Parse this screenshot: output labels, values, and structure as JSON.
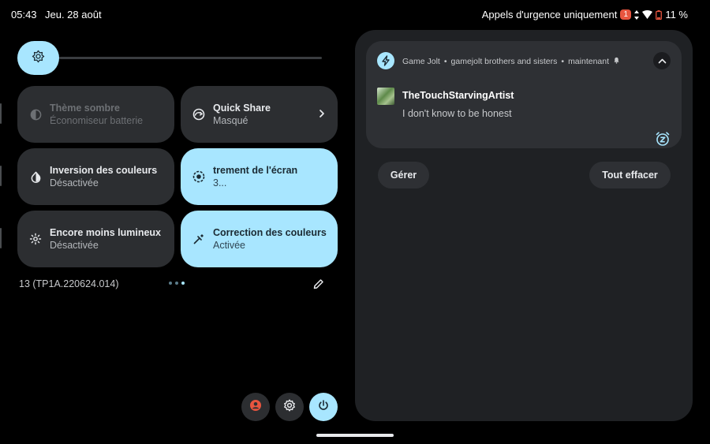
{
  "status_bar": {
    "time": "05:43",
    "date": "Jeu. 28 août",
    "carrier_text": "Appels d'urgence uniquement",
    "notification_count": "1",
    "battery": "11 %"
  },
  "quick_settings": {
    "tiles": [
      {
        "label": "Thème sombre",
        "sublabel": "Économiseur batterie",
        "icon": "dark-theme-icon",
        "state": "unavailable"
      },
      {
        "label": "Quick Share",
        "sublabel": "Masqué",
        "icon": "quick-share-icon",
        "state": "off"
      },
      {
        "label": "Inversion des couleurs",
        "sublabel": "Désactivée",
        "icon": "color-inversion-icon",
        "state": "off"
      },
      {
        "label": "trement de l'écran",
        "sublabel": "3...",
        "icon": "screen-record-icon",
        "state": "on"
      },
      {
        "label": "Encore moins lumineux",
        "sublabel": "Désactivée",
        "icon": "extra-dim-icon",
        "state": "off"
      },
      {
        "label": "Correction des couleurs",
        "sublabel": "Activée",
        "icon": "color-correction-icon",
        "state": "on"
      }
    ],
    "build_number": "13 (TP1A.220624.014)",
    "page_count": 3,
    "current_page": 3
  },
  "notification": {
    "app_name": "Game Jolt",
    "channel": "gamejolt brothers and sisters",
    "time": "maintenant",
    "title": "TheTouchStarvingArtist",
    "text": "I don't know to be honest"
  },
  "notification_actions": {
    "manage": "Gérer",
    "clear_all": "Tout effacer"
  },
  "colors": {
    "accent": "#a8e6ff",
    "tile_bg": "#2c2e31",
    "panel_bg": "#1f2124",
    "badge": "#e8553f"
  }
}
